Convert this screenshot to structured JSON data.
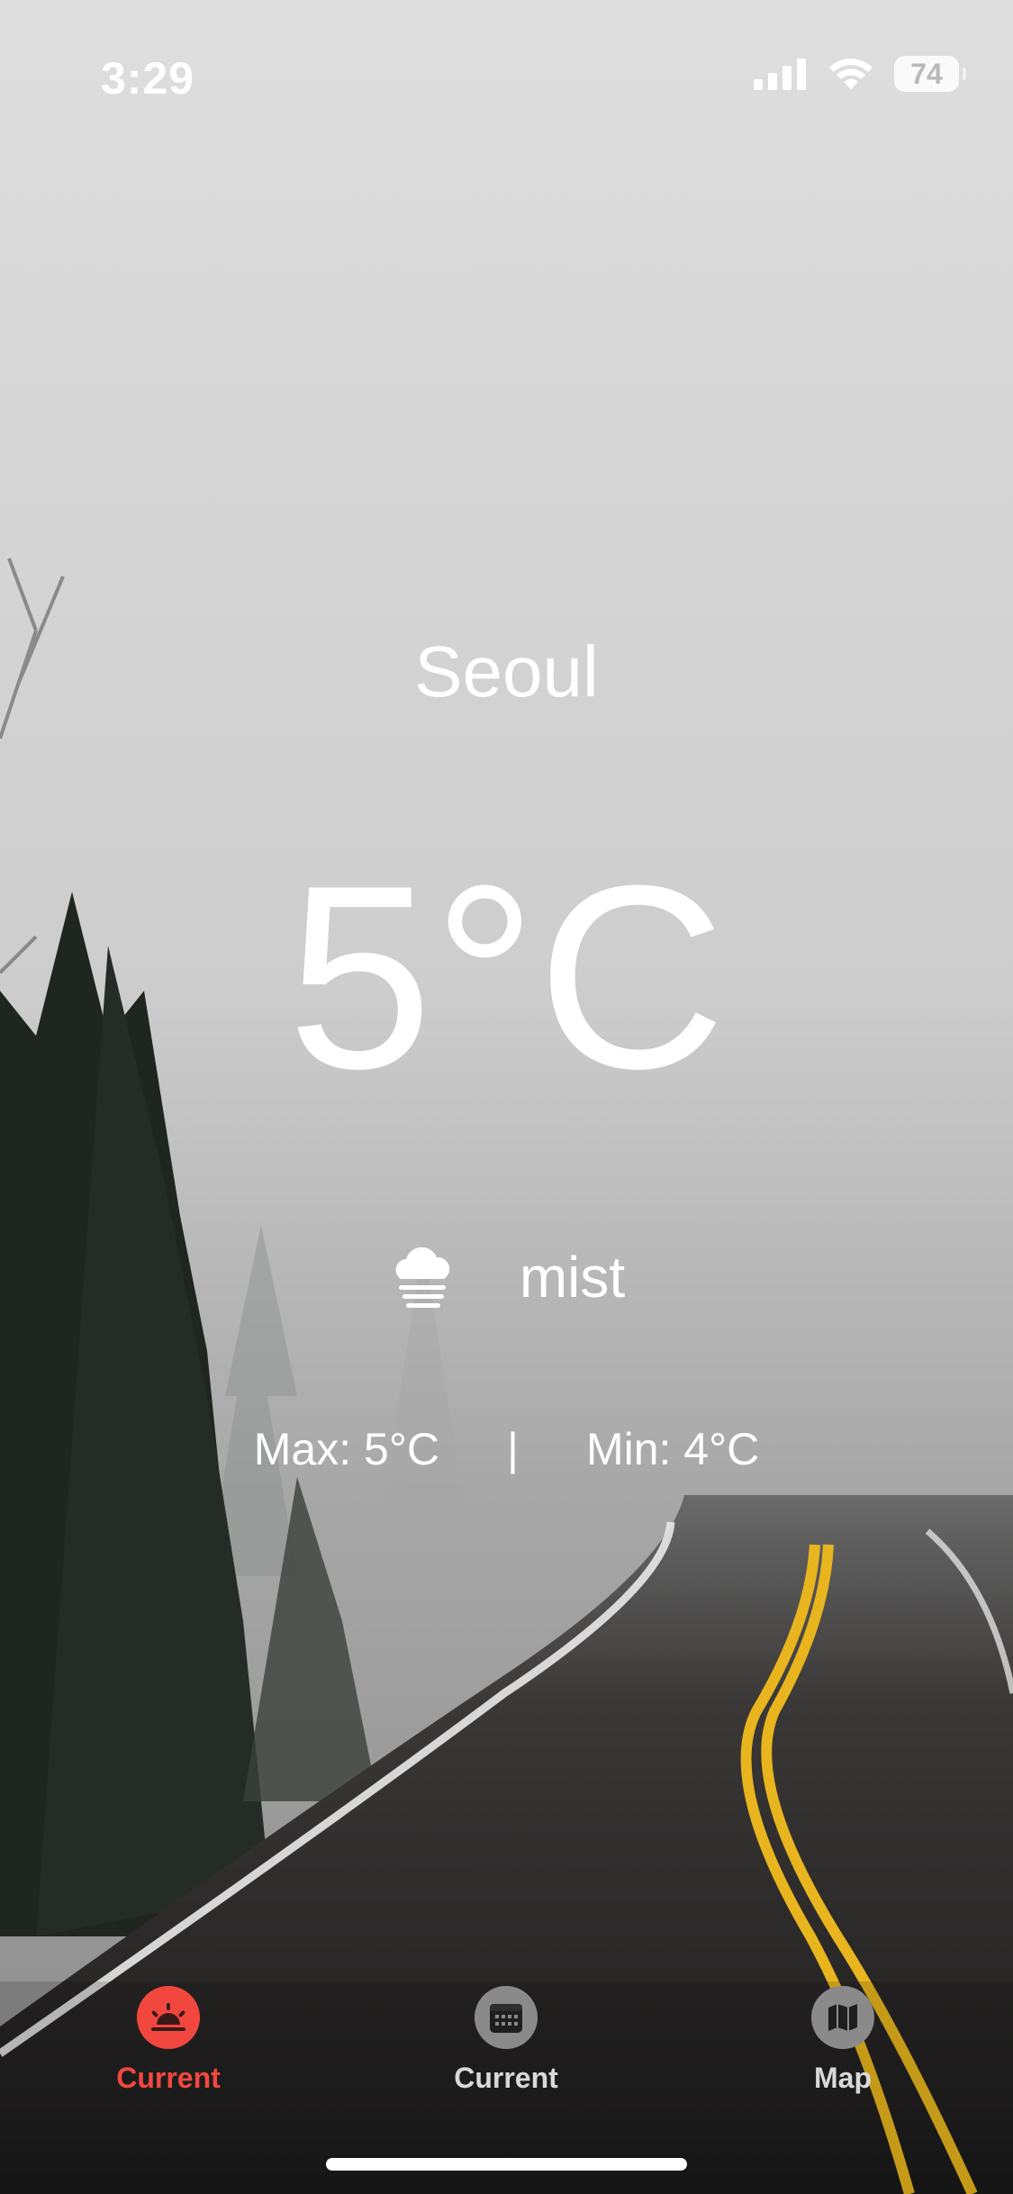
{
  "status_bar": {
    "time": "3:29",
    "battery": "74"
  },
  "weather": {
    "city": "Seoul",
    "temperature": "5°C",
    "condition": "mist",
    "condition_icon": "fog-cloud-icon",
    "max": "Max: 5°C",
    "separator": "|",
    "min": "Min: 4°C"
  },
  "tabbar": {
    "items": [
      {
        "label": "Current",
        "icon": "sunrise-icon",
        "active": true
      },
      {
        "label": "Current",
        "icon": "calendar-icon",
        "active": false
      },
      {
        "label": "Map",
        "icon": "map-icon",
        "active": false
      }
    ],
    "active_color": "#f2473f",
    "inactive_color": "#d9d9d9"
  }
}
